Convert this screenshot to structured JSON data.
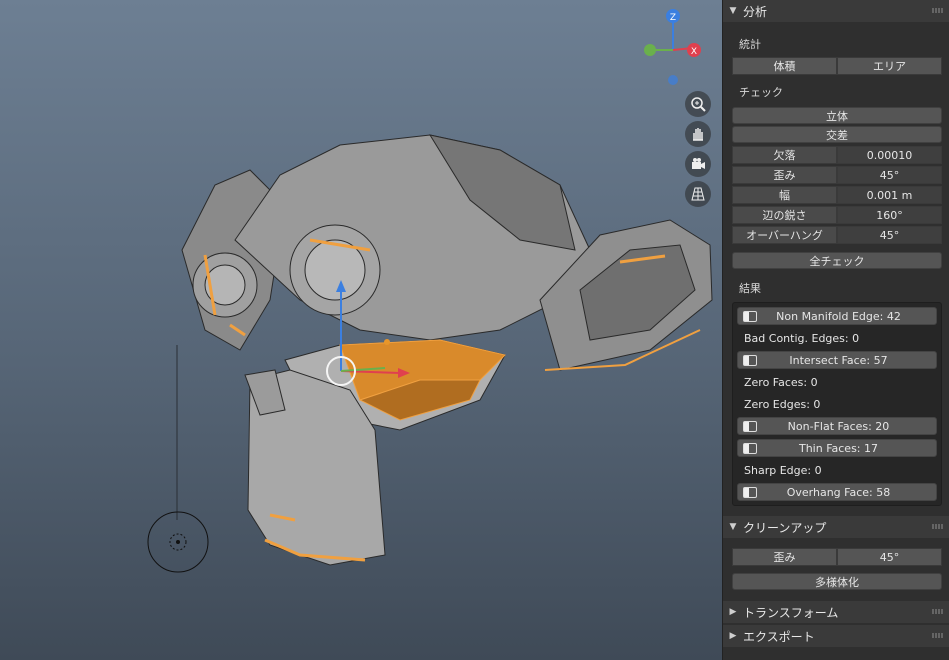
{
  "viewport": {
    "axes": {
      "z": "Z",
      "x": "X",
      "y": "Y"
    },
    "nav_icons": [
      "zoom-icon",
      "hand-icon",
      "camera-icon",
      "grid-icon"
    ]
  },
  "panel": {
    "analysis": {
      "title": "分析",
      "stats_label": "統計",
      "volume_button": "体積",
      "area_button": "エリア",
      "check_label": "チェック",
      "solid_button": "立体",
      "intersect_button": "交差",
      "checks": [
        {
          "label": "欠落",
          "value": "0.00010"
        },
        {
          "label": "歪み",
          "value": "45°"
        },
        {
          "label": "幅",
          "value": "0.001 m"
        },
        {
          "label": "辺の鋭さ",
          "value": "160°"
        },
        {
          "label": "オーバーハング",
          "value": "45°"
        }
      ],
      "check_all_button": "全チェック",
      "result_label": "結果",
      "results": {
        "non_manifold": "Non Manifold Edge: 42",
        "bad_contig": "Bad Contig. Edges: 0",
        "intersect_face": "Intersect Face: 57",
        "zero_faces": "Zero Faces: 0",
        "zero_edges": "Zero Edges: 0",
        "non_flat": "Non-Flat Faces: 20",
        "thin_faces": "Thin Faces: 17",
        "sharp_edge": "Sharp Edge: 0",
        "overhang": "Overhang Face: 58"
      }
    },
    "cleanup": {
      "title": "クリーンアップ",
      "distort_label": "歪み",
      "distort_value": "45°",
      "make_manifold_button": "多様体化"
    },
    "transform": {
      "title": "トランスフォーム"
    },
    "export": {
      "title": "エクスポート"
    }
  },
  "colors": {
    "accent_orange": "#e8962a",
    "axis_x": "#e0404e",
    "axis_y": "#6ab04c",
    "axis_z": "#3b7fe0"
  }
}
